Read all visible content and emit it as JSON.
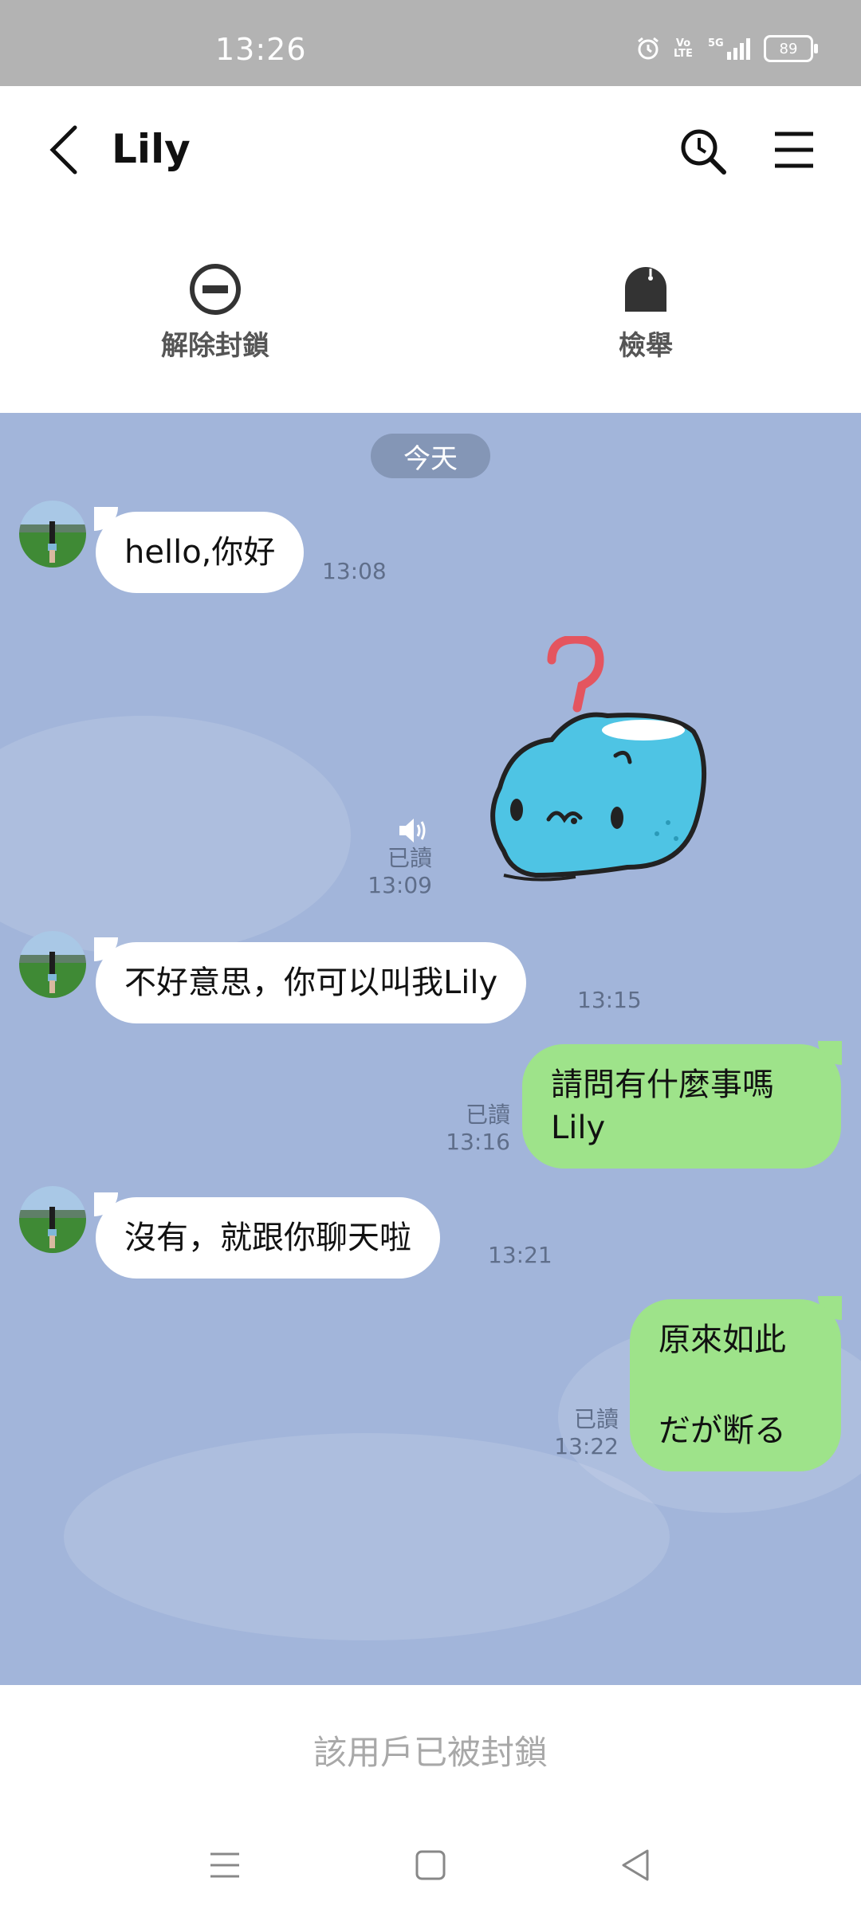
{
  "status": {
    "time": "13:26",
    "battery": "89",
    "network": "5G",
    "volte": "Vo LTE"
  },
  "header": {
    "title": "Lily"
  },
  "actions": [
    {
      "label": "解除封鎖",
      "icon": "unblock-icon"
    },
    {
      "label": "檢舉",
      "icon": "report-icon"
    }
  ],
  "chat": {
    "date": "今天",
    "messages": [
      {
        "dir": "in",
        "text": "hello,你好",
        "time": "13:08"
      },
      {
        "dir": "out",
        "type": "sticker",
        "read": "已讀",
        "time": "13:09"
      },
      {
        "dir": "in",
        "text": "不好意思，你可以叫我Lily",
        "time": "13:15"
      },
      {
        "dir": "out",
        "text": "請問有什麼事嗎 Lily",
        "lines": [
          "請問有什麼事嗎",
          "Lily"
        ],
        "read": "已讀",
        "time": "13:16"
      },
      {
        "dir": "in",
        "text": "沒有，就跟你聊天啦",
        "time": "13:21"
      },
      {
        "dir": "out",
        "text": "原來如此 だが断る",
        "lines": [
          "原來如此",
          "だが断る"
        ],
        "read": "已讀",
        "time": "13:22"
      }
    ]
  },
  "footer": {
    "blocked_notice": "該用戶已被封鎖"
  },
  "colors": {
    "chat_bg": "#a2b5da",
    "outgoing": "#9ee38a",
    "incoming": "#ffffff",
    "status_bar": "#b3b3b3"
  }
}
